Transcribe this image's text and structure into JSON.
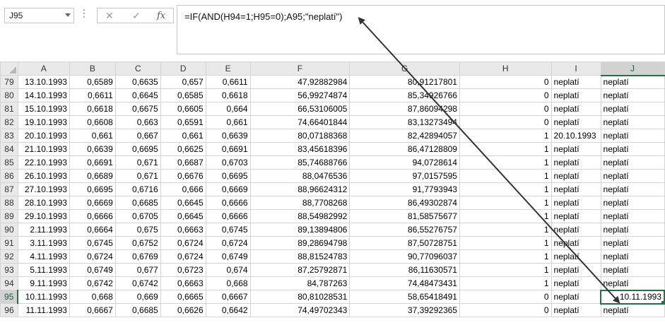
{
  "name_box": "J95",
  "formula_bar": {
    "cancel": "✕",
    "enter": "✓",
    "fx": "fx",
    "formula": "=IF(AND(H94=1;H95=0);A95;\"neplatí\")"
  },
  "columns": [
    "A",
    "B",
    "C",
    "D",
    "E",
    "F",
    "G",
    "H",
    "I",
    "J"
  ],
  "rows": [
    {
      "n": "79",
      "A": "13.10.1993",
      "B": "0,6589",
      "C": "0,6635",
      "D": "0,657",
      "E": "0,6611",
      "F": "47,92882984",
      "G": "80,91217801",
      "H": "0",
      "I": "neplatí",
      "J": "neplatí"
    },
    {
      "n": "80",
      "A": "14.10.1993",
      "B": "0,6611",
      "C": "0,6645",
      "D": "0,6585",
      "E": "0,6618",
      "F": "56,99274874",
      "G": "85,34926766",
      "H": "0",
      "I": "neplatí",
      "J": "neplatí"
    },
    {
      "n": "81",
      "A": "15.10.1993",
      "B": "0,6618",
      "C": "0,6675",
      "D": "0,6605",
      "E": "0,664",
      "F": "66,53106005",
      "G": "87,86094298",
      "H": "0",
      "I": "neplatí",
      "J": "neplatí"
    },
    {
      "n": "82",
      "A": "19.10.1993",
      "B": "0,6608",
      "C": "0,663",
      "D": "0,6591",
      "E": "0,661",
      "F": "74,66401844",
      "G": "83,13273494",
      "H": "0",
      "I": "neplatí",
      "J": "neplatí"
    },
    {
      "n": "83",
      "A": "20.10.1993",
      "B": "0,661",
      "C": "0,667",
      "D": "0,661",
      "E": "0,6639",
      "F": "80,07188368",
      "G": "82,42894057",
      "H": "1",
      "I": "20.10.1993",
      "J": "neplatí"
    },
    {
      "n": "84",
      "A": "21.10.1993",
      "B": "0,6639",
      "C": "0,6695",
      "D": "0,6625",
      "E": "0,6691",
      "F": "83,45618396",
      "G": "86,47128809",
      "H": "1",
      "I": "neplatí",
      "J": "neplatí"
    },
    {
      "n": "85",
      "A": "22.10.1993",
      "B": "0,6691",
      "C": "0,671",
      "D": "0,6687",
      "E": "0,6703",
      "F": "85,74688766",
      "G": "94,0728614",
      "H": "1",
      "I": "neplatí",
      "J": "neplatí"
    },
    {
      "n": "86",
      "A": "26.10.1993",
      "B": "0,6689",
      "C": "0,671",
      "D": "0,6676",
      "E": "0,6695",
      "F": "88,0476536",
      "G": "97,0157595",
      "H": "1",
      "I": "neplatí",
      "J": "neplatí"
    },
    {
      "n": "87",
      "A": "27.10.1993",
      "B": "0,6695",
      "C": "0,6716",
      "D": "0,666",
      "E": "0,6669",
      "F": "88,96624312",
      "G": "91,7793943",
      "H": "1",
      "I": "neplatí",
      "J": "neplatí"
    },
    {
      "n": "88",
      "A": "28.10.1993",
      "B": "0,6669",
      "C": "0,6685",
      "D": "0,6645",
      "E": "0,6666",
      "F": "88,7708268",
      "G": "86,49302874",
      "H": "1",
      "I": "neplatí",
      "J": "neplatí"
    },
    {
      "n": "89",
      "A": "29.10.1993",
      "B": "0,6666",
      "C": "0,6705",
      "D": "0,6645",
      "E": "0,6666",
      "F": "88,54982992",
      "G": "81,58575677",
      "H": "1",
      "I": "neplatí",
      "J": "neplatí"
    },
    {
      "n": "90",
      "A": "2.11.1993",
      "B": "0,6664",
      "C": "0,675",
      "D": "0,6663",
      "E": "0,6745",
      "F": "89,13894806",
      "G": "86,55276757",
      "H": "1",
      "I": "neplatí",
      "J": "neplatí"
    },
    {
      "n": "91",
      "A": "3.11.1993",
      "B": "0,6745",
      "C": "0,6752",
      "D": "0,6724",
      "E": "0,6724",
      "F": "89,28694798",
      "G": "87,50728751",
      "H": "1",
      "I": "neplatí",
      "J": "neplatí"
    },
    {
      "n": "92",
      "A": "4.11.1993",
      "B": "0,6724",
      "C": "0,6769",
      "D": "0,6724",
      "E": "0,6749",
      "F": "88,81524783",
      "G": "90,77096037",
      "H": "1",
      "I": "neplatí",
      "J": "neplatí"
    },
    {
      "n": "93",
      "A": "5.11.1993",
      "B": "0,6749",
      "C": "0,677",
      "D": "0,6723",
      "E": "0,674",
      "F": "87,25792871",
      "G": "86,11630571",
      "H": "1",
      "I": "neplatí",
      "J": "neplatí"
    },
    {
      "n": "94",
      "A": "9.11.1993",
      "B": "0,6742",
      "C": "0,6742",
      "D": "0,6663",
      "E": "0,668",
      "F": "84,787263",
      "G": "74,48473431",
      "H": "1",
      "I": "neplatí",
      "J": "neplatí"
    },
    {
      "n": "95",
      "A": "10.11.1993",
      "B": "0,668",
      "C": "0,669",
      "D": "0,6665",
      "E": "0,6667",
      "F": "80,81028531",
      "G": "58,65418491",
      "H": "0",
      "I": "neplatí",
      "J": "10.11.1993"
    },
    {
      "n": "96",
      "A": "11.11.1993",
      "B": "0,6667",
      "C": "0,6685",
      "D": "0,6626",
      "E": "0,6642",
      "F": "74,49702343",
      "G": "37,39292365",
      "H": "0",
      "I": "neplatí",
      "J": "neplatí"
    }
  ],
  "selected": {
    "row": "95",
    "col": "J"
  },
  "colors": {
    "accent": "#217346",
    "arrow": "#333333"
  }
}
